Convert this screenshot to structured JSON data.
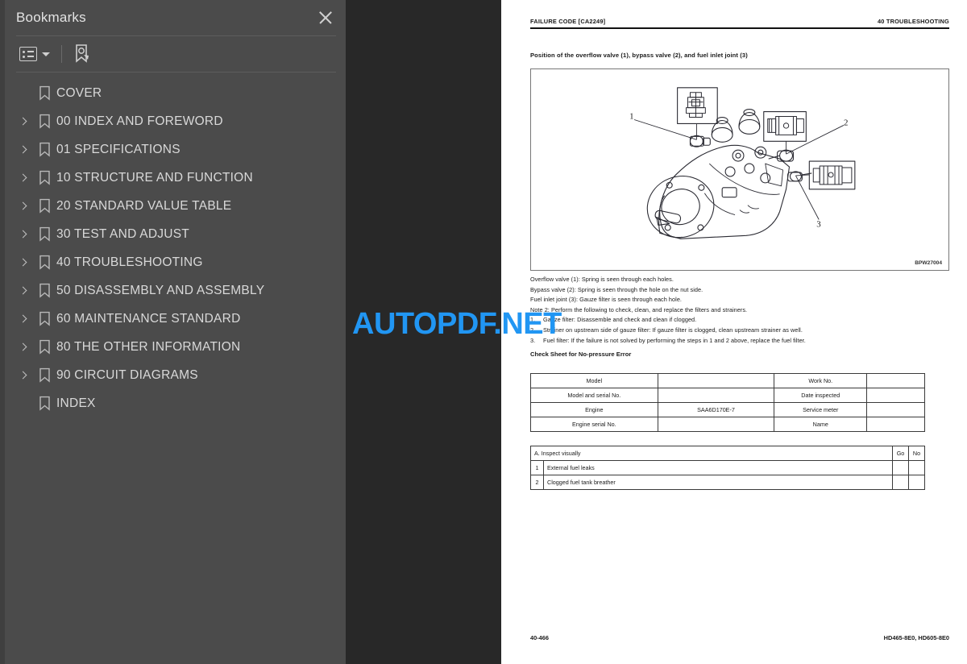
{
  "sidebar": {
    "title": "Bookmarks",
    "close_icon": "close-icon",
    "toolbar": {
      "options_icon": "list-options-icon",
      "dropdown_caret_icon": "chevron-down-icon",
      "new_bookmark_icon": "new-bookmark-icon"
    },
    "items": [
      {
        "label": "COVER",
        "expandable": false
      },
      {
        "label": "00 INDEX AND FOREWORD",
        "expandable": true
      },
      {
        "label": "01 SPECIFICATIONS",
        "expandable": true
      },
      {
        "label": "10 STRUCTURE AND FUNCTION",
        "expandable": true
      },
      {
        "label": "20 STANDARD VALUE TABLE",
        "expandable": true
      },
      {
        "label": "30 TEST AND ADJUST",
        "expandable": true
      },
      {
        "label": "40 TROUBLESHOOTING",
        "expandable": true
      },
      {
        "label": "50 DISASSEMBLY AND ASSEMBLY",
        "expandable": true
      },
      {
        "label": "60 MAINTENANCE STANDARD",
        "expandable": true
      },
      {
        "label": "80 THE OTHER INFORMATION",
        "expandable": true
      },
      {
        "label": "90 CIRCUIT DIAGRAMS",
        "expandable": true
      },
      {
        "label": "INDEX",
        "expandable": false
      }
    ]
  },
  "watermark": {
    "text": "AUTOPDF.NET",
    "color": "#2196f3"
  },
  "document": {
    "header_left": "FAILURE CODE [CA2249]",
    "header_right": "40 TROUBLESHOOTING",
    "figure_caption": "Position of the overflow valve (1), bypass valve (2), and fuel inlet joint (3)",
    "figure_code": "BPW27004",
    "figure_callouts": [
      "1",
      "2",
      "3"
    ],
    "body_lines": [
      "Overflow valve (1): Spring is seen through each holes.",
      "Bypass valve (2): Spring is seen through the hole on the nut side.",
      "Fuel inlet joint (3): Gauze filter is seen through each hole.",
      "Note 2:  Perform the following to check, clean, and replace the filters and strainers."
    ],
    "numbered_steps": [
      {
        "num": "1.",
        "text": "Gauze filter: Disassemble and check and clean if clogged."
      },
      {
        "num": "2.",
        "text": "Strainer on upstream side of gauze filter: If gauze filter is clogged, clean upstream strainer as well."
      },
      {
        "num": "3.",
        "text": "Fuel filter: If the failure is not solved by performing the steps in 1 and 2 above, replace the fuel filter."
      }
    ],
    "check_sheet_title": "Check Sheet for No-pressure Error",
    "model_table": [
      {
        "label": "Model",
        "value": "",
        "label2": "Work No.",
        "value2": ""
      },
      {
        "label": "Model and serial No.",
        "value": "",
        "label2": "Date inspected",
        "value2": ""
      },
      {
        "label": "Engine",
        "value": "SAA6D170E-7",
        "label2": "Service meter",
        "value2": ""
      },
      {
        "label": "Engine serial No.",
        "value": "",
        "label2": "Name",
        "value2": ""
      }
    ],
    "check_table": {
      "section": "A. Inspect visually",
      "col_go": "Go",
      "col_no": "No",
      "rows": [
        {
          "num": "1",
          "text": "External fuel leaks"
        },
        {
          "num": "2",
          "text": "Clogged fuel tank breather"
        }
      ]
    },
    "footer_left": "40-466",
    "footer_right": "HD465-8E0, HD605-8E0"
  }
}
